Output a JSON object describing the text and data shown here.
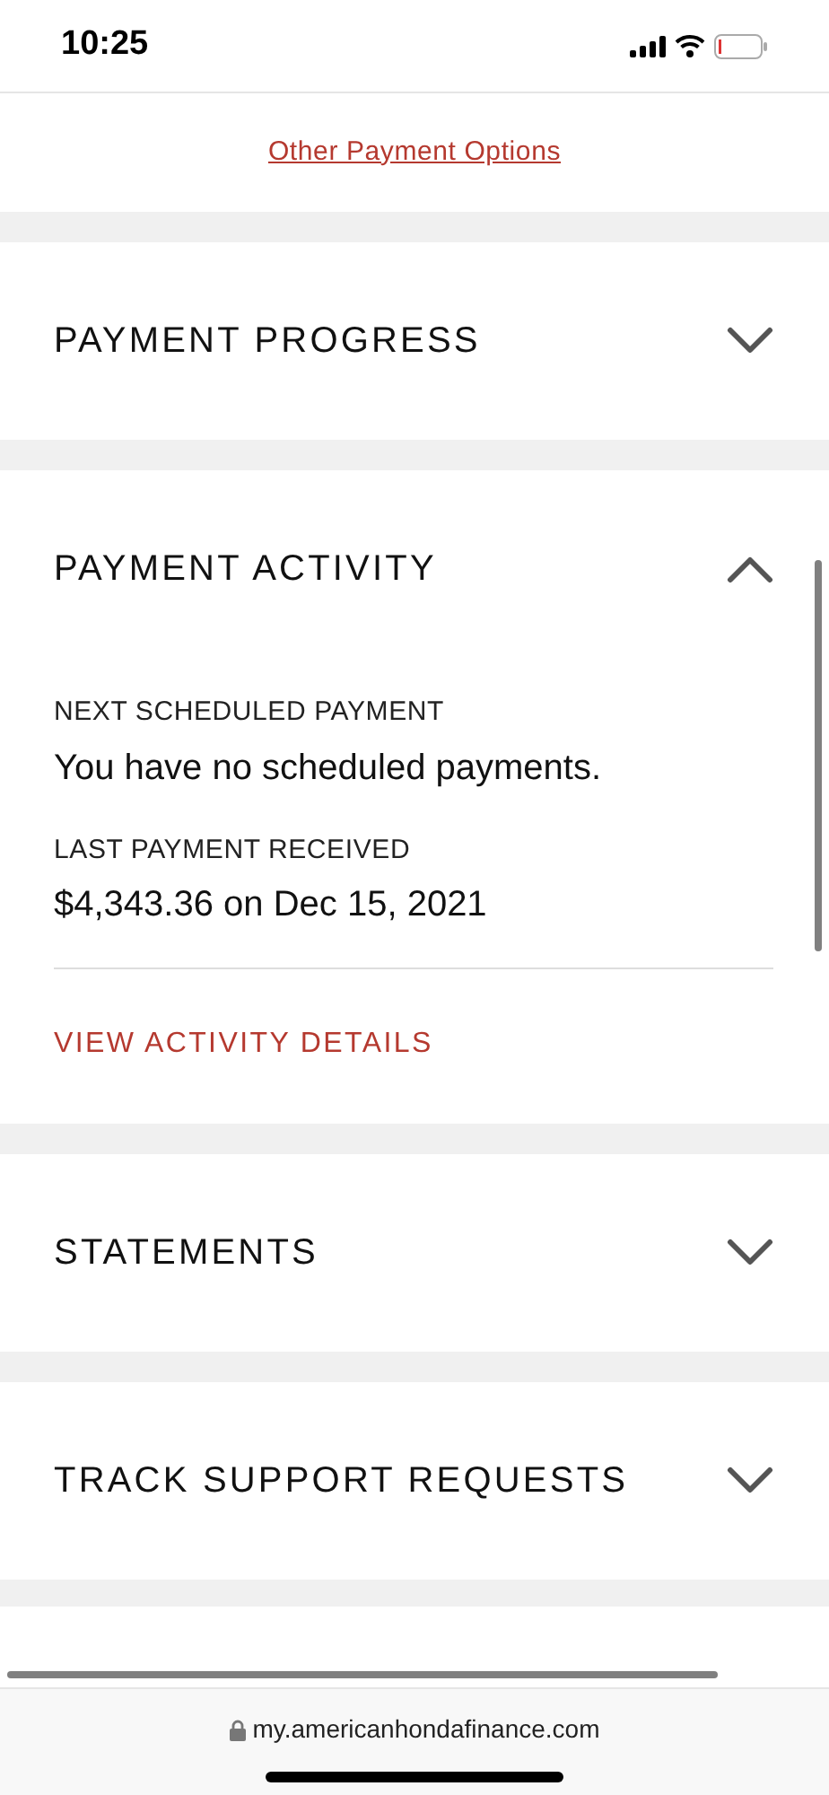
{
  "status_bar": {
    "time": "10:25"
  },
  "link": "Other Payment Options",
  "sections": [
    {
      "title": "PAYMENT PROGRESS",
      "expanded": false
    },
    {
      "title": "PAYMENT ACTIVITY",
      "expanded": true,
      "fields": [
        {
          "label": "NEXT SCHEDULED PAYMENT",
          "value": "You have no scheduled payments."
        },
        {
          "label": "LAST PAYMENT RECEIVED",
          "value": "$4,343.36 on Dec 15, 2021"
        }
      ],
      "action": "VIEW ACTIVITY DETAILS"
    },
    {
      "title": "STATEMENTS",
      "expanded": false
    },
    {
      "title": "TRACK SUPPORT REQUESTS",
      "expanded": false
    }
  ],
  "address_bar": {
    "url": "my.americanhondafinance.com"
  }
}
